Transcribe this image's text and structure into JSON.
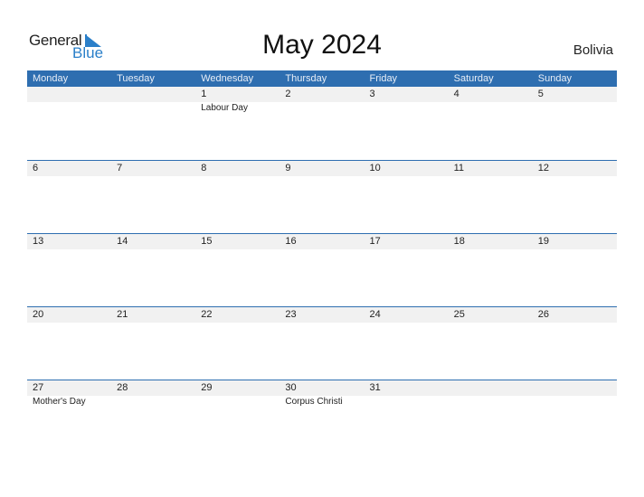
{
  "logo": {
    "line1": "General",
    "line2": "Blue"
  },
  "title": "May 2024",
  "country": "Bolivia",
  "colors": {
    "header": "#2e6eb0",
    "brand": "#2a7fc9",
    "band": "#f1f1f1"
  },
  "weekdays": [
    "Monday",
    "Tuesday",
    "Wednesday",
    "Thursday",
    "Friday",
    "Saturday",
    "Sunday"
  ],
  "weeks": [
    {
      "days": [
        "",
        "",
        "1",
        "2",
        "3",
        "4",
        "5"
      ],
      "events": [
        "",
        "",
        "Labour Day",
        "",
        "",
        "",
        ""
      ]
    },
    {
      "days": [
        "6",
        "7",
        "8",
        "9",
        "10",
        "11",
        "12"
      ],
      "events": [
        "",
        "",
        "",
        "",
        "",
        "",
        ""
      ]
    },
    {
      "days": [
        "13",
        "14",
        "15",
        "16",
        "17",
        "18",
        "19"
      ],
      "events": [
        "",
        "",
        "",
        "",
        "",
        "",
        ""
      ]
    },
    {
      "days": [
        "20",
        "21",
        "22",
        "23",
        "24",
        "25",
        "26"
      ],
      "events": [
        "",
        "",
        "",
        "",
        "",
        "",
        ""
      ]
    },
    {
      "days": [
        "27",
        "28",
        "29",
        "30",
        "31",
        "",
        ""
      ],
      "events": [
        "Mother's Day",
        "",
        "",
        "Corpus Christi",
        "",
        "",
        ""
      ]
    }
  ]
}
